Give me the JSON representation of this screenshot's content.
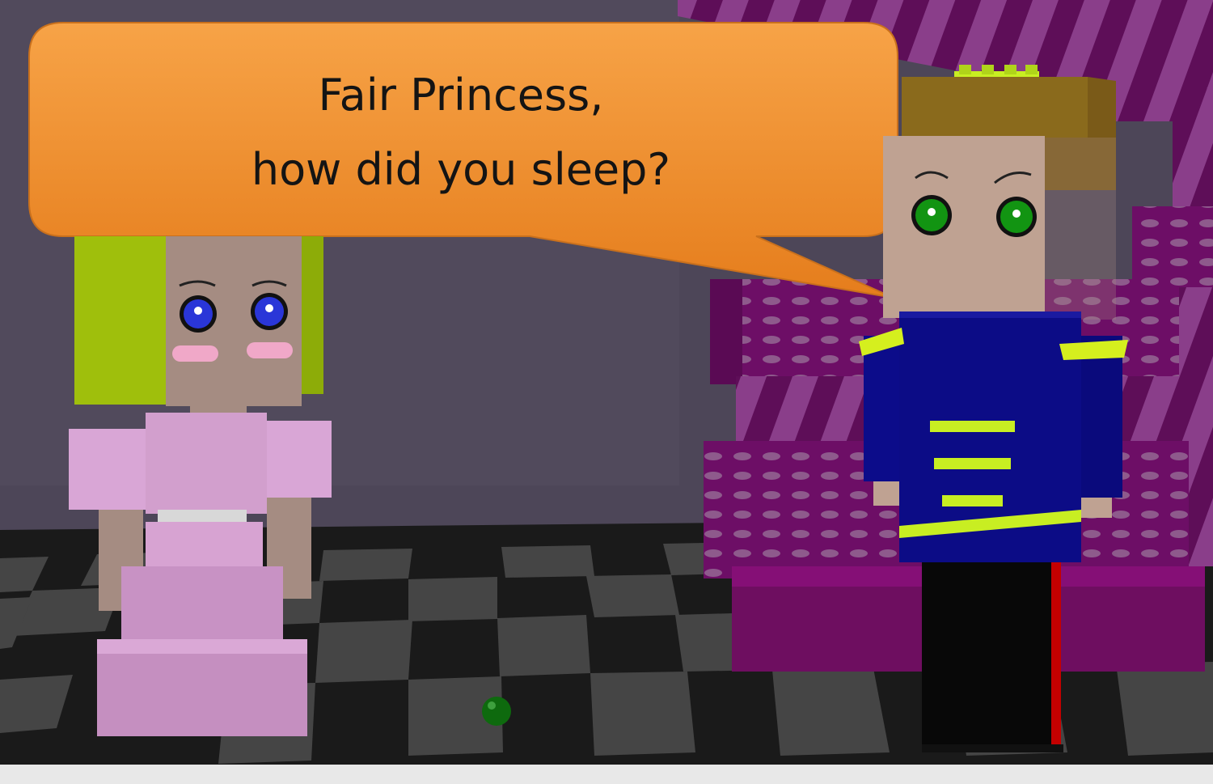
{
  "dialogue": {
    "line_1": "Fair Princess,",
    "line_2": "how did you sleep?"
  },
  "characters": {
    "princess": {
      "hair_color": "#a6c40e",
      "dress_color": "#d79fd0",
      "eye_color": "#2a36d8"
    },
    "prince": {
      "hair_color": "#8a6a1c",
      "tunic_color": "#0c0c86",
      "eye_color": "#129412",
      "crown_color": "#c8ee22"
    }
  },
  "colors": {
    "speech_bubble": "#f08a25",
    "wall": "#4d4658",
    "throne": "#7a0a6e",
    "floor_dark": "#1a1a1a",
    "floor_light": "#4a4a4a"
  }
}
